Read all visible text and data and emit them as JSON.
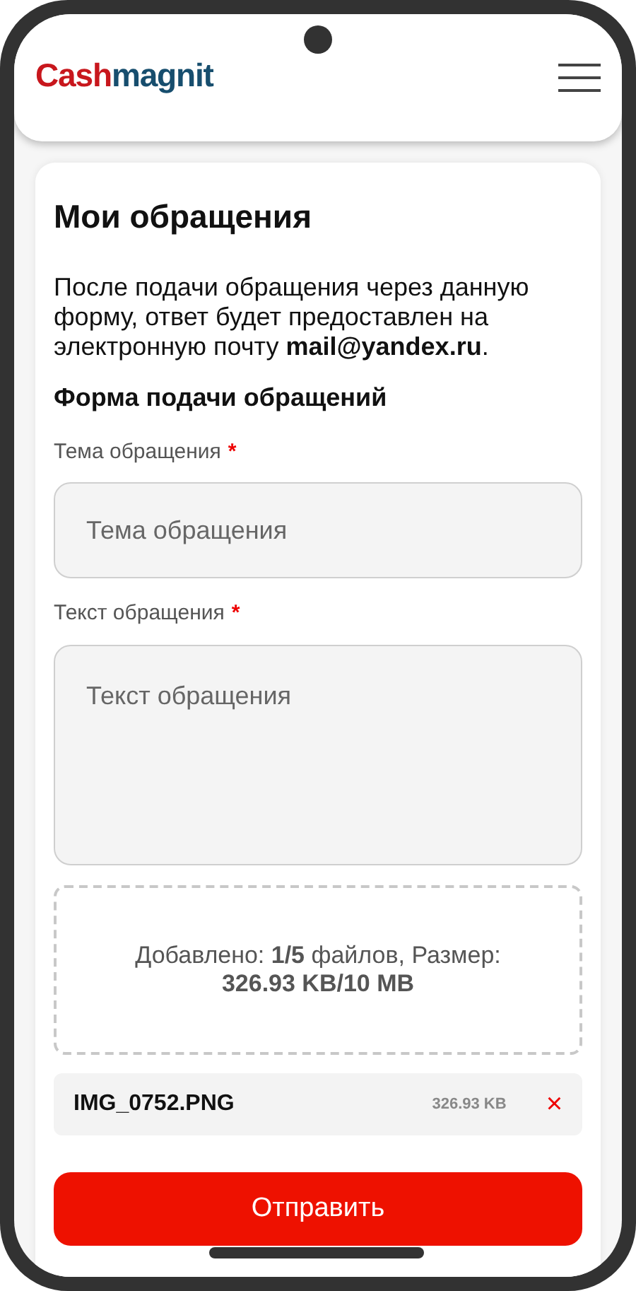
{
  "header": {
    "logo": [
      "Cash",
      "magnit"
    ]
  },
  "page": {
    "title": "Мои обращения",
    "intro": "После подачи обращения через данную форму, ответ будет предоставлен на электронную почту **mail@yandex.ru**.",
    "form_title": "Форма подачи обращений"
  },
  "fields": [
    {
      "kind": "input",
      "label": "Тема обращения",
      "required": true,
      "placeholder": "Тема обращения"
    },
    {
      "kind": "textarea",
      "label": "Текст обращения",
      "required": true,
      "placeholder": "Текст обращения"
    }
  ],
  "required_mark": "*",
  "upload": {
    "summary": "Добавлено: **1/5** файлов, Размер: **326.93 KB/10 MB**"
  },
  "files": [
    {
      "name": "IMG_0752.PNG",
      "size": "326.93 KB",
      "remove": "×"
    }
  ],
  "submit": "Отправить"
}
